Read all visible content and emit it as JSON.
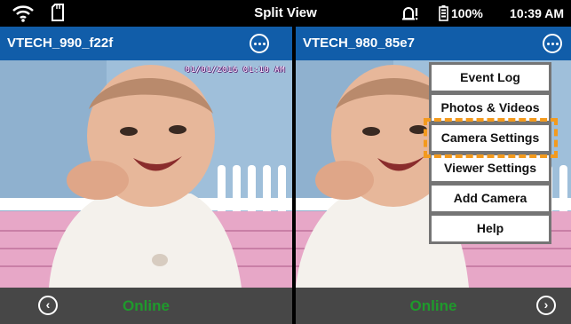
{
  "status_bar": {
    "title": "Split View",
    "battery": "100%",
    "time": "10:39 AM"
  },
  "icons": {
    "wifi": "wifi-icon",
    "storage": "sd-card-icon",
    "alert": "alert-bell-icon",
    "battery": "battery-icon",
    "more": "more-options-icon",
    "prev": "chevron-left-icon",
    "next": "chevron-right-icon"
  },
  "cameras": [
    {
      "name": "VTECH_990_f22f",
      "timestamp": "01/01/2016 01:10 AM",
      "status": "Online"
    },
    {
      "name": "VTECH_980_85e7",
      "timestamp": "",
      "status": "Online"
    }
  ],
  "menu": {
    "items": [
      "Event Log",
      "Photos & Videos",
      "Camera Settings",
      "Viewer Settings",
      "Add Camera",
      "Help"
    ],
    "highlighted_item": "Camera Settings"
  },
  "colors": {
    "header_blue": "#115da9",
    "online_green": "#1f9a2c",
    "footer_gray": "#474747",
    "highlight_orange": "#f39a1d"
  }
}
